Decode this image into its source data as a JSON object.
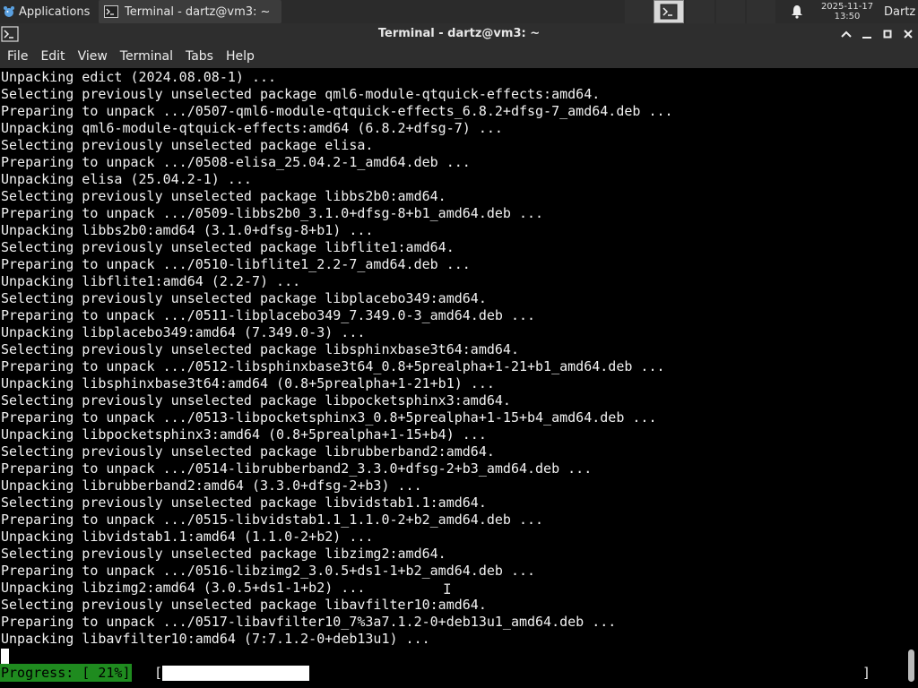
{
  "panel": {
    "apps_label": "Applications",
    "task_label": "Terminal - dartz@vm3: ~",
    "clock_date": "2025-11-17",
    "clock_time": "13:50",
    "user_label": "Dartz"
  },
  "window": {
    "title": "Terminal - dartz@vm3: ~"
  },
  "menu": {
    "file": "File",
    "edit": "Edit",
    "view": "View",
    "terminal": "Terminal",
    "tabs": "Tabs",
    "help": "Help"
  },
  "terminal": {
    "lines": [
      "Unpacking edict (2024.08.08-1) ...",
      "Selecting previously unselected package qml6-module-qtquick-effects:amd64.",
      "Preparing to unpack .../0507-qml6-module-qtquick-effects_6.8.2+dfsg-7_amd64.deb ...",
      "Unpacking qml6-module-qtquick-effects:amd64 (6.8.2+dfsg-7) ...",
      "Selecting previously unselected package elisa.",
      "Preparing to unpack .../0508-elisa_25.04.2-1_amd64.deb ...",
      "Unpacking elisa (25.04.2-1) ...",
      "Selecting previously unselected package libbs2b0:amd64.",
      "Preparing to unpack .../0509-libbs2b0_3.1.0+dfsg-8+b1_amd64.deb ...",
      "Unpacking libbs2b0:amd64 (3.1.0+dfsg-8+b1) ...",
      "Selecting previously unselected package libflite1:amd64.",
      "Preparing to unpack .../0510-libflite1_2.2-7_amd64.deb ...",
      "Unpacking libflite1:amd64 (2.2-7) ...",
      "Selecting previously unselected package libplacebo349:amd64.",
      "Preparing to unpack .../0511-libplacebo349_7.349.0-3_amd64.deb ...",
      "Unpacking libplacebo349:amd64 (7.349.0-3) ...",
      "Selecting previously unselected package libsphinxbase3t64:amd64.",
      "Preparing to unpack .../0512-libsphinxbase3t64_0.8+5prealpha+1-21+b1_amd64.deb ...",
      "Unpacking libsphinxbase3t64:amd64 (0.8+5prealpha+1-21+b1) ...",
      "Selecting previously unselected package libpocketsphinx3:amd64.",
      "Preparing to unpack .../0513-libpocketsphinx3_0.8+5prealpha+1-15+b4_amd64.deb ...",
      "Unpacking libpocketsphinx3:amd64 (0.8+5prealpha+1-15+b4) ...",
      "Selecting previously unselected package librubberband2:amd64.",
      "Preparing to unpack .../0514-librubberband2_3.3.0+dfsg-2+b3_amd64.deb ...",
      "Unpacking librubberband2:amd64 (3.3.0+dfsg-2+b3) ...",
      "Selecting previously unselected package libvidstab1.1:amd64.",
      "Preparing to unpack .../0515-libvidstab1.1_1.1.0-2+b2_amd64.deb ...",
      "Unpacking libvidstab1.1:amd64 (1.1.0-2+b2) ...",
      "Selecting previously unselected package libzimg2:amd64.",
      "Preparing to unpack .../0516-libzimg2_3.0.5+ds1-1+b2_amd64.deb ...",
      "Unpacking libzimg2:amd64 (3.0.5+ds1-1+b2) ...",
      "Selecting previously unselected package libavfilter10:amd64.",
      "Preparing to unpack .../0517-libavfilter10_7%3a7.1.2-0+deb13u1_amd64.deb ...",
      "Unpacking libavfilter10:amd64 (7:7.1.2-0+deb13u1) ..."
    ],
    "progress_label": "Progress: [ 21%]",
    "bracket_open": "[",
    "bracket_close": "]",
    "progress_fraction": 0.21
  },
  "colors": {
    "panel_bg": "#2b2b2b",
    "terminal_bg": "#000000",
    "terminal_text": "#f2f2f2",
    "progress_green": "#1f8b1f"
  },
  "icons": {
    "apps": "xfce-mouse-icon",
    "terminal": "terminal-icon",
    "bell": "bell-icon",
    "minimize": "minimize-icon",
    "maximize": "maximize-icon",
    "close": "close-icon",
    "shade": "chevron-up-icon"
  }
}
